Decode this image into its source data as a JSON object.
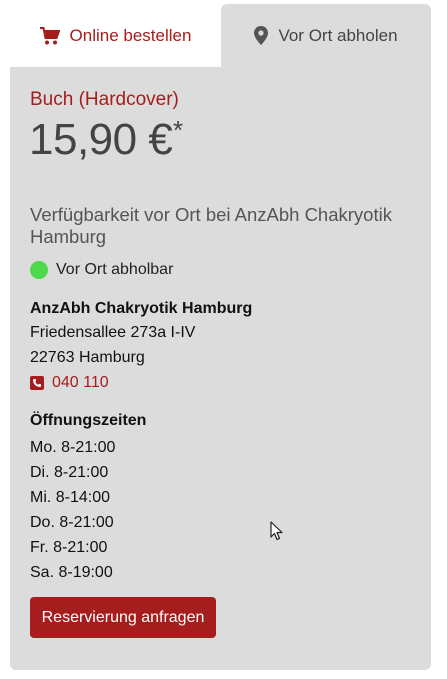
{
  "tabs": {
    "online_label": "Online bestellen",
    "pickup_label": "Vor Ort abholen"
  },
  "product": {
    "format": "Buch (Hardcover)",
    "price": "15,90 €",
    "price_footnote": "*"
  },
  "availability": {
    "title": "Verfügbarkeit vor Ort bei AnzAbh Chakryotik Hamburg",
    "status": "Vor Ort abholbar"
  },
  "store": {
    "name": "AnzAbh Chakryotik Hamburg",
    "street": "Friedensallee 273a I-IV",
    "city": "22763 Hamburg",
    "phone": "040 110"
  },
  "hours": {
    "title": "Öffnungszeiten",
    "rows": [
      "Mo. 8-21:00",
      "Di. 8-21:00",
      "Mi. 8-14:00",
      "Do. 8-21:00",
      "Fr. 8-21:00",
      "Sa. 8-19:00"
    ]
  },
  "actions": {
    "reserve_label": "Reservierung anfragen"
  },
  "colors": {
    "accent": "#a61d1d",
    "panel": "#dcdcdc",
    "status_green": "#4cd94c"
  },
  "icons": {
    "online_tab": "cart-icon",
    "pickup_tab": "map-pin-icon",
    "phone": "phone-icon"
  }
}
